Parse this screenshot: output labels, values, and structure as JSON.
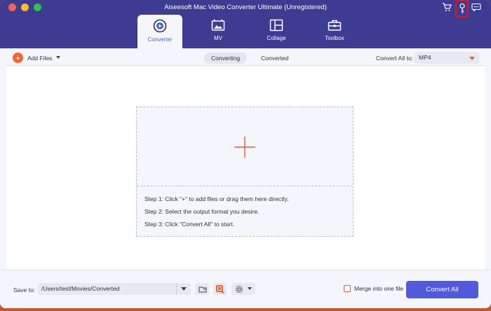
{
  "window": {
    "title": "Aiseesoft Mac Video Converter Ultimate (Unregistered)"
  },
  "header_icons": [
    "cart-icon",
    "key-icon",
    "chat-icon"
  ],
  "tabs": [
    {
      "label": "Converter",
      "icon": "converter-icon",
      "active": true
    },
    {
      "label": "MV",
      "icon": "mv-icon",
      "active": false
    },
    {
      "label": "Collage",
      "icon": "collage-icon",
      "active": false
    },
    {
      "label": "Toolbox",
      "icon": "toolbox-icon",
      "active": false
    }
  ],
  "toolbar": {
    "add_files_label": "Add Files",
    "segments": [
      "Converting",
      "Converted"
    ],
    "active_segment": "Converting",
    "convert_all_label": "Convert All to:",
    "format_value": "MP4"
  },
  "dropzone": {
    "steps": [
      "Step 1: Click \"+\" to add files or drag them here directly.",
      "Step 2: Select the output format you desire.",
      "Step 3: Click \"Convert All\" to start."
    ]
  },
  "bottom": {
    "save_to_label": "Save to:",
    "save_path": "/Users/test/Movies/Converted",
    "merge_label": "Merge into one file",
    "merge_checked": false,
    "convert_button_label": "Convert All"
  },
  "colors": {
    "header_bg": "#3d3c92",
    "accent": "#5159dc",
    "orange": "#f06431",
    "highlight_box": "#e0161c"
  }
}
